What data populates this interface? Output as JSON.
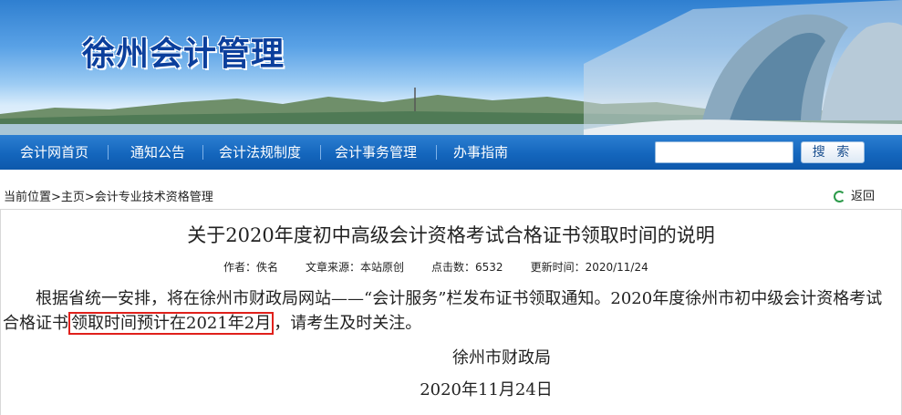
{
  "site": {
    "title": "徐州会计管理"
  },
  "nav": {
    "items": [
      "会计网首页",
      "通知公告",
      "会计法规制度",
      "会计事务管理",
      "办事指南"
    ],
    "search_button": "搜 索",
    "search_placeholder": ""
  },
  "breadcrumb": {
    "text": "当前位置>主页>会计专业技术资格管理",
    "back_label": "返回"
  },
  "article": {
    "title": "关于2020年度初中高级会计资格考试合格证书领取时间的说明",
    "author": "作者：佚名",
    "source": "文章来源：本站原创",
    "hits": "点击数：6532",
    "updated": "更新时间：2020/11/24",
    "body_part1": "根据省统一安排，将在徐州市财政局网站——“会计服务”栏发布证书领取通知。2020年度徐州市初中级会计资格考试合格证书",
    "body_highlight": "领取时间预计在2021年2月",
    "body_part2": "，请考生及时关注。",
    "signature": "徐州市财政局",
    "date": "2020年11月24日"
  },
  "colors": {
    "nav_bg": "#1466bd",
    "title_blue": "#0b3f9c",
    "highlight_border": "#e0201b"
  }
}
